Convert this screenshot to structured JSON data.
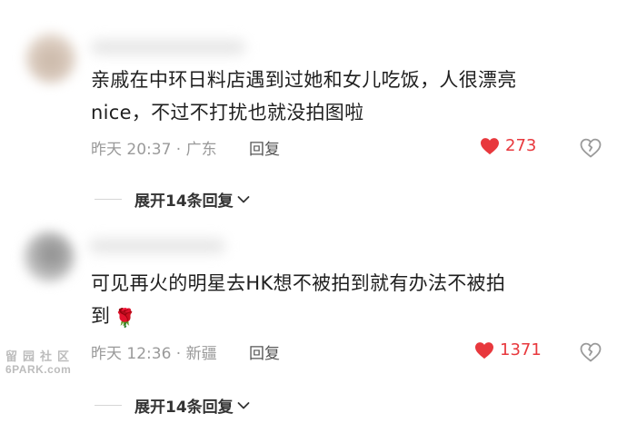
{
  "comments": [
    {
      "text_line1": "亲戚在中环日料店遇到过她和女儿吃饭，人很漂亮",
      "text_line2": "nice，不过不打扰也就没拍图啦",
      "meta": "昨天 20:37 · 广东",
      "reply_label": "回复",
      "likes": "273",
      "expand_label": "展开14条回复"
    },
    {
      "text_line1": "可见再火的明星去HK想不被拍到就有办法不被拍",
      "text_line2": "到",
      "emoji_icon": "rose-icon",
      "meta": "昨天 12:36 · 新疆",
      "reply_label": "回复",
      "likes": "1371",
      "expand_label": "展开14条回复"
    }
  ],
  "watermark": {
    "line1": "留园社区",
    "line2": "6PARK.com"
  },
  "colors": {
    "like": "#e8383d",
    "meta": "#9a9a9a",
    "text": "#1f1f1f"
  }
}
